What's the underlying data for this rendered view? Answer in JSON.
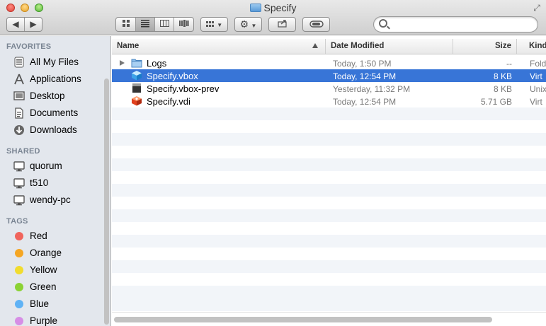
{
  "window": {
    "title": "Specify"
  },
  "toolbar": {
    "view_icon": "icon-view",
    "list_icon": "list-view",
    "column_icon": "column-view",
    "coverflow_icon": "coverflow-view",
    "arrange_icon": "arrange-menu",
    "action_icon": "gear-action-menu",
    "share_icon": "share",
    "tags_icon": "edit-tags",
    "search_placeholder": ""
  },
  "sidebar": {
    "favorites_header": "FAVORITES",
    "favorites": [
      {
        "label": "All My Files",
        "icon": "all-files-icon"
      },
      {
        "label": "Applications",
        "icon": "applications-icon"
      },
      {
        "label": "Desktop",
        "icon": "desktop-icon"
      },
      {
        "label": "Documents",
        "icon": "documents-icon"
      },
      {
        "label": "Downloads",
        "icon": "downloads-icon"
      }
    ],
    "shared_header": "SHARED",
    "shared": [
      {
        "label": "quorum",
        "icon": "computer-icon"
      },
      {
        "label": "t510",
        "icon": "computer-icon"
      },
      {
        "label": "wendy-pc",
        "icon": "computer-icon"
      }
    ],
    "tags_header": "TAGS",
    "tags": [
      {
        "label": "Red",
        "color": "#f0645c"
      },
      {
        "label": "Orange",
        "color": "#f5a623"
      },
      {
        "label": "Yellow",
        "color": "#f1dc2e"
      },
      {
        "label": "Green",
        "color": "#8bd234"
      },
      {
        "label": "Blue",
        "color": "#5fb2f5"
      },
      {
        "label": "Purple",
        "color": "#d68ee6"
      }
    ]
  },
  "columns": {
    "name": "Name",
    "date": "Date Modified",
    "size": "Size",
    "kind": "Kind"
  },
  "files": [
    {
      "name": "Logs",
      "date": "Today, 1:50 PM",
      "size": "--",
      "kind": "Fold",
      "icon": "folder-icon",
      "selected": false
    },
    {
      "name": "Specify.vbox",
      "date": "Today, 12:54 PM",
      "size": "8 KB",
      "kind": "Virt",
      "icon": "vbox-icon",
      "selected": true
    },
    {
      "name": "Specify.vbox-prev",
      "date": "Yesterday, 11:32 PM",
      "size": "8 KB",
      "kind": "Unix",
      "icon": "document-icon",
      "selected": false
    },
    {
      "name": "Specify.vdi",
      "date": "Today, 12:54 PM",
      "size": "5.71 GB",
      "kind": "Virt",
      "icon": "vdi-icon",
      "selected": false
    }
  ],
  "colors": {
    "selection": "#3875d7",
    "sidebar_bg": "#e3e7ed",
    "alt_row": "#f2f5f9"
  }
}
